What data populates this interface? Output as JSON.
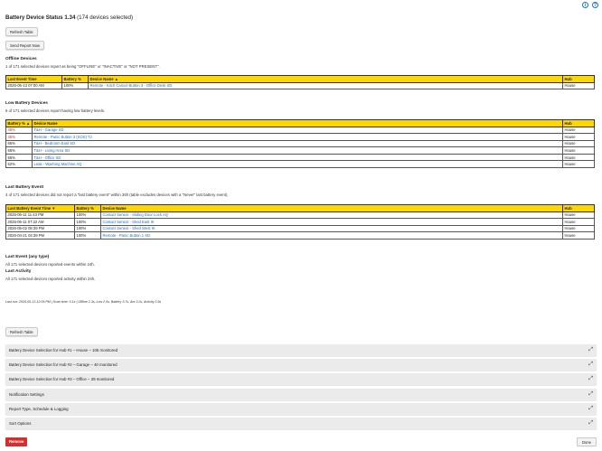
{
  "header": {
    "title": "Battery Device Status 1.34",
    "subtitle": "(174 devices selected)",
    "info_glyph": "i",
    "help_glyph": "?"
  },
  "buttons": {
    "refresh_top": "Refresh Table",
    "send_report": "Send Report Now",
    "refresh_bottom": "Refresh Table",
    "remove": "Remove",
    "done": "Done"
  },
  "offline": {
    "heading": "Offline Devices",
    "desc": "1 of 171 selected devices report as being \"OFFLINE\" or \"INACTIVE\" or \"NOT PRESENT\".",
    "columns": [
      "Last Event Time",
      "Battery %",
      "Device Name ▲",
      "Hub"
    ],
    "rows": [
      {
        "time": "2026-05-13 07:00 AM",
        "battery": "100%",
        "name": "Remote - Kitch Cancel Button 3 - Office Desk SD",
        "hub": "House"
      }
    ]
  },
  "low": {
    "heading": "Low Battery Devices",
    "desc": "6 of 171 selected devices report having low battery levels.",
    "columns": [
      "Battery % ▲",
      "Device Name",
      "Hub"
    ],
    "rows": [
      {
        "battery": "45%",
        "name": "T&H - Garage SD",
        "hub": "House",
        "red": true
      },
      {
        "battery": "45%",
        "name": "Remote - Panic Button 3 (SOS) TJ",
        "hub": "House",
        "red": true
      },
      {
        "battery": "65%",
        "name": "T&H - Bedroom East SD",
        "hub": "House",
        "red": false
      },
      {
        "battery": "65%",
        "name": "T&H - Living Area SD",
        "hub": "House",
        "red": false
      },
      {
        "battery": "65%",
        "name": "T&H - Office SD",
        "hub": "House",
        "red": false
      },
      {
        "battery": "52%",
        "name": "Leak - Washing Machine AQ",
        "hub": "House",
        "red": false
      }
    ]
  },
  "last_battery": {
    "heading": "Last Battery Event",
    "desc": "4 of 171 selected devices did not report a \"last battery event\" within 36h (table excludes devices with a \"Never\" last battery event).",
    "columns": [
      "Last Battery Event Time ▼",
      "Battery %",
      "Device Name",
      "Hub"
    ],
    "rows": [
      {
        "time": "2026-05-11 11:43 PM",
        "battery": "100%",
        "name": "Contact Sensor - Sliding Door Lock AQ",
        "hub": "House"
      },
      {
        "time": "2026-05-11 07:22 AM",
        "battery": "100%",
        "name": "Contact Sensor - Shed East IK",
        "hub": "House"
      },
      {
        "time": "2026-05-02 05:39 PM",
        "battery": "100%",
        "name": "Contact Sensor - Shed West IK",
        "hub": "House"
      },
      {
        "time": "2026-04-21 04:39 PM",
        "battery": "100%",
        "name": "Remote - Panic Button 1 SD",
        "hub": "House"
      }
    ]
  },
  "last_event": {
    "heading": "Last Event (any type)",
    "desc": "All 171 selected devices reported events within 24h."
  },
  "last_activity": {
    "heading": "Last Activity",
    "desc": "All 171 selected devices reported activity within 24h."
  },
  "meta": "Last run: 2026-05-13 12:09 PM | Scan time: 0.1s | Offline 2.3s, Low 2.0s, Battery 3.7s, Ant 3.2s, Activity 2.9s",
  "accordions": [
    "Battery Device Selection for Hub #1 – House – 105 monitored",
    "Battery Device Selection for Hub #2 – Garage – 40 monitored",
    "Battery Device Selection for Hub #3 – Office – 29 monitored",
    "Notification Settings",
    "Report Type, Schedule & Logging",
    "Sort Options"
  ],
  "colors": {
    "header_bg": "#ffd700",
    "link": "#1a6fc4",
    "alert": "#d32f2f",
    "panel": "#ebebeb"
  }
}
